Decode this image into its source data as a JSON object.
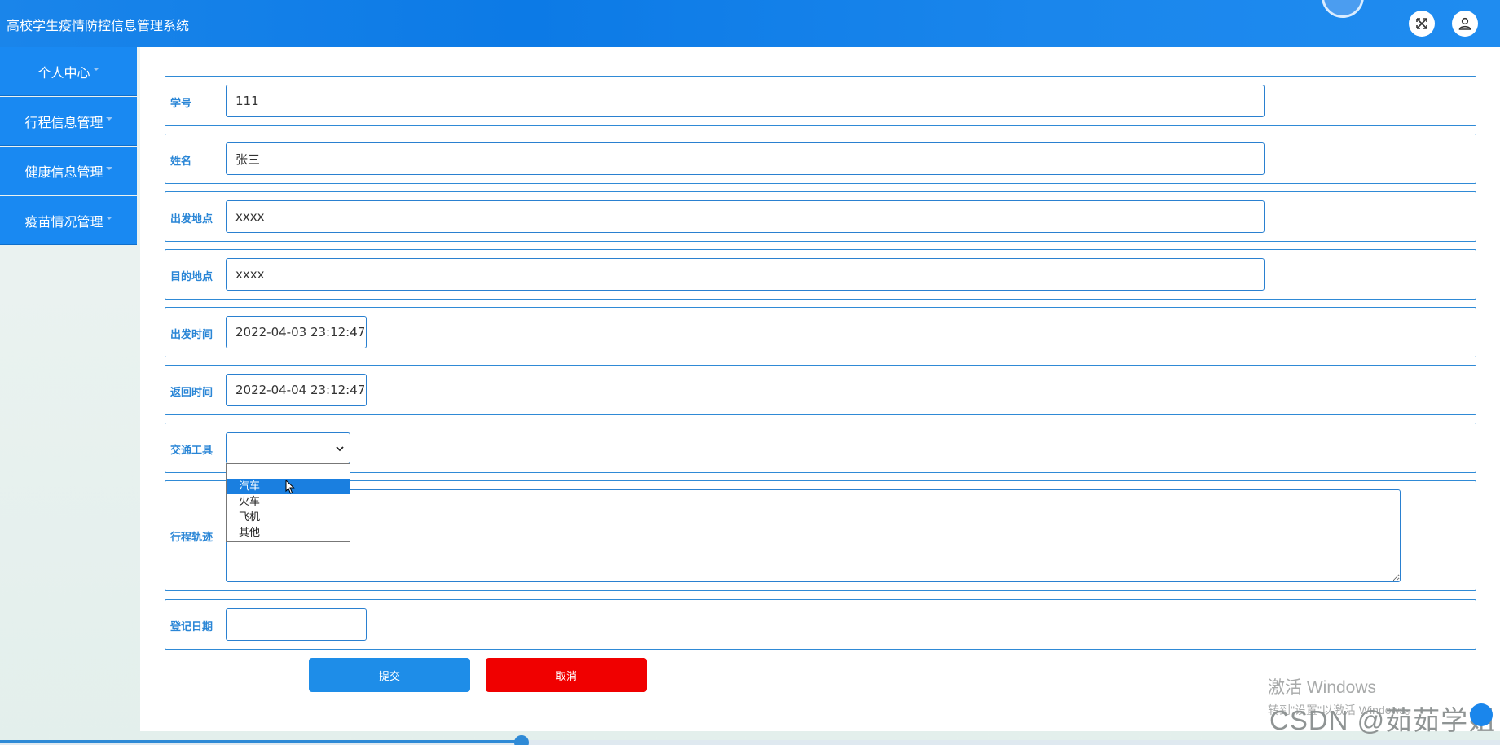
{
  "app": {
    "title": "高校学生疫情防控信息管理系统"
  },
  "header": {
    "fullscreen_icon": "fullscreen-icon",
    "user_icon": "user-icon"
  },
  "sidebar": {
    "items": [
      {
        "label": "个人中心"
      },
      {
        "label": "行程信息管理"
      },
      {
        "label": "健康信息管理"
      },
      {
        "label": "疫苗情况管理"
      }
    ]
  },
  "form": {
    "student_id": {
      "label": "学号",
      "value": "111"
    },
    "name": {
      "label": "姓名",
      "value": "张三"
    },
    "departure": {
      "label": "出发地点",
      "value": "xxxx"
    },
    "destination": {
      "label": "目的地点",
      "value": "xxxx"
    },
    "depart_time": {
      "label": "出发时间",
      "value": "2022-04-03 23:12:47"
    },
    "return_time": {
      "label": "返回时间",
      "value": "2022-04-04 23:12:47"
    },
    "transport": {
      "label": "交通工具",
      "value": "",
      "options": [
        "",
        "汽车",
        "火车",
        "飞机",
        "其他"
      ],
      "highlighted": "汽车"
    },
    "trajectory": {
      "label": "行程轨迹",
      "value": ""
    },
    "register_date": {
      "label": "登记日期",
      "value": ""
    },
    "submit_label": "提交",
    "cancel_label": "取消"
  },
  "watermarks": {
    "activate_line1": "激活 Windows",
    "activate_line2": "转到\"设置\"以激活 Windows。",
    "csdn": "CSDN @茹茹学姐"
  },
  "colors": {
    "header": "#0c7ae6",
    "sidebar": "#1989f2",
    "border": "#2f8ad6",
    "submit": "#1e8de8",
    "cancel": "#f00000"
  }
}
